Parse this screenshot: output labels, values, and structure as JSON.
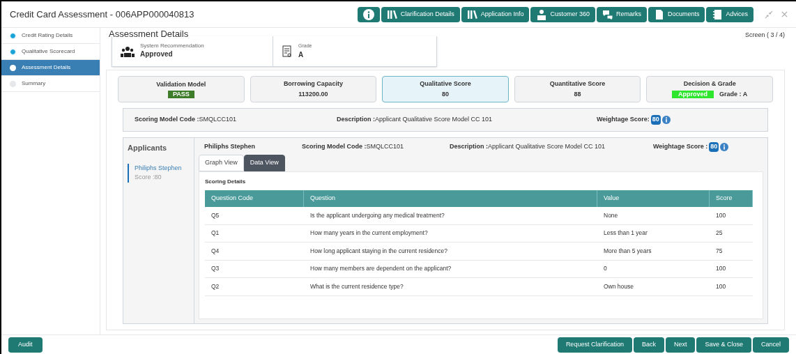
{
  "window": {
    "title": "Credit Card Assessment - 006APP000040813"
  },
  "toolbar": [
    {
      "kind": "info"
    },
    {
      "label": "Clarification Details",
      "kind": "books"
    },
    {
      "label": "Application Info",
      "kind": "books"
    },
    {
      "label": "Customer 360",
      "kind": "person"
    },
    {
      "label": "Remarks",
      "kind": "chat"
    },
    {
      "label": "Documents",
      "kind": "doc"
    },
    {
      "label": "Advices",
      "kind": "notebook"
    }
  ],
  "sidebar": {
    "items": [
      {
        "label": "Credit Rating Details",
        "completed": true,
        "selected": false
      },
      {
        "label": "Qualitative Scorecard",
        "completed": true,
        "selected": false
      },
      {
        "label": "Assessment Details",
        "completed": false,
        "selected": true
      },
      {
        "label": "Summary",
        "completed": false,
        "selected": false
      }
    ]
  },
  "page": {
    "title": "Assessment Details",
    "screen": "Screen ( 3 / 4)"
  },
  "recommendation": {
    "label": "System Recommendation",
    "value": "Approved"
  },
  "grade": {
    "label": "Grade",
    "value": "A"
  },
  "score_cards": [
    {
      "title": "Validation Model",
      "value": "PASS",
      "kind": "badge",
      "selected": false
    },
    {
      "title": "Borrowing Capacity",
      "value": "113200.00",
      "kind": "text",
      "selected": false
    },
    {
      "title": "Qualitative Score",
      "value": "80",
      "kind": "text",
      "selected": true
    },
    {
      "title": "Quantitative Score",
      "value": "88",
      "kind": "text",
      "selected": false
    },
    {
      "title": "Decision & Grade",
      "value": "Approved",
      "extra": "Grade : A",
      "kind": "decision",
      "selected": false
    }
  ],
  "model": {
    "code_label": "Scoring Model Code :",
    "code": "SMQLCC101",
    "desc_label": "Description :",
    "desc": "Applicant Qualitative Score Model CC 101",
    "weight_label": "Weightage Score:",
    "weight": "80"
  },
  "applicants": {
    "title": "Applicants",
    "items": [
      {
        "name": "Philiphs Stephen",
        "score": "Score :80",
        "selected": true
      }
    ]
  },
  "applicant_detail": {
    "name": "Philiphs Stephen",
    "code_label": "Scoring Model Code :",
    "code": "SMQLCC101",
    "desc_label": "Description :",
    "desc": "Applicant Qualitative Score Model CC 101",
    "weight_label": "Weightage Score :",
    "weight": "80"
  },
  "view_tabs": [
    {
      "label": "Graph View",
      "selected": false
    },
    {
      "label": "Data View",
      "selected": true
    }
  ],
  "table": {
    "title": "Scoring Details",
    "columns": [
      "Question Code",
      "Question",
      "Value",
      "Score"
    ],
    "rows": [
      [
        "Q5",
        "Is the applicant undergoing any medical treatment?",
        "None",
        "100"
      ],
      [
        "Q1",
        "How many years in the current employment?",
        "Less than 1 year",
        "25"
      ],
      [
        "Q4",
        "How long applicant staying in the current residence?",
        "More than 5 years",
        "75"
      ],
      [
        "Q3",
        "How many members are dependent on the applicant?",
        "0",
        "100"
      ],
      [
        "Q2",
        "What is the current residence type?",
        "Own house",
        "100"
      ]
    ]
  },
  "footer": {
    "left": [
      "Audit"
    ],
    "right": [
      "Request Clarification",
      "Back",
      "Next",
      "Save & Close",
      "Cancel"
    ]
  }
}
